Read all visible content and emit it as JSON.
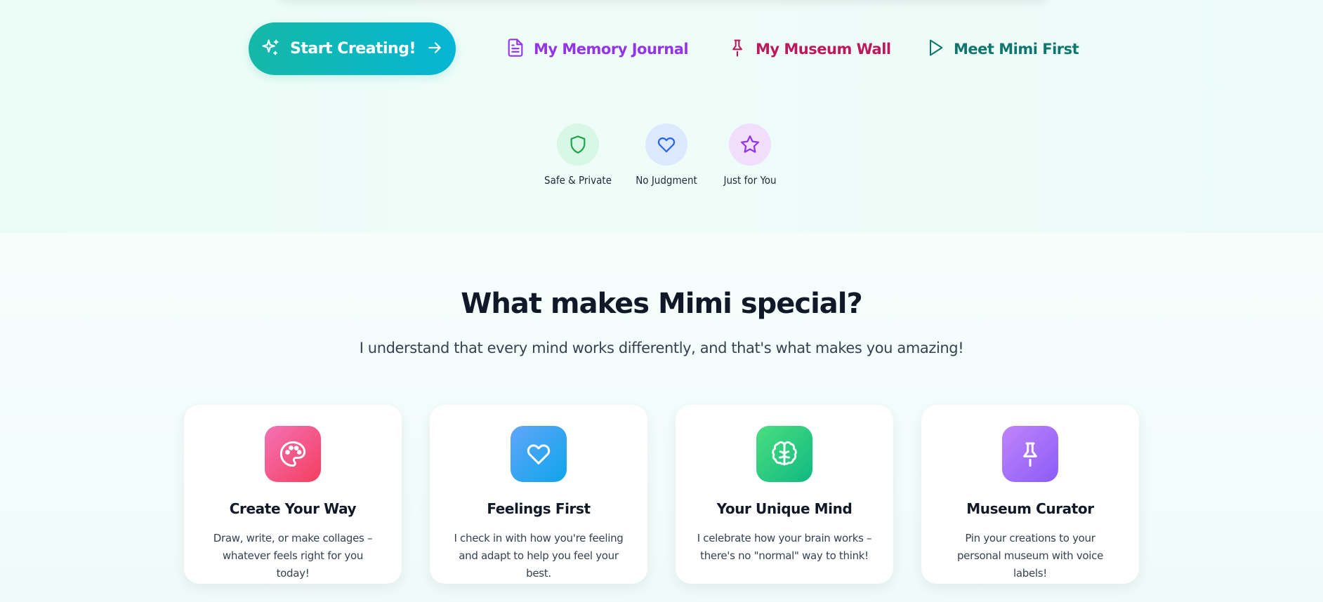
{
  "hero": {
    "cta": {
      "label": "Start Creating!",
      "icon": "sparkles-icon",
      "arrow_icon": "arrow-right-icon"
    },
    "nav_links": [
      {
        "label": "My Memory Journal",
        "icon": "document-icon",
        "color": "#9333ea"
      },
      {
        "label": "My Museum Wall",
        "icon": "pin-icon",
        "color": "#be185d"
      },
      {
        "label": "Meet Mimi First",
        "icon": "play-icon",
        "color": "#0f766e"
      }
    ],
    "trust_badges": [
      {
        "label": "Safe & Private",
        "icon": "shield-icon",
        "color": "#16a34a"
      },
      {
        "label": "No Judgment",
        "icon": "heart-icon",
        "color": "#2563eb"
      },
      {
        "label": "Just for You",
        "icon": "star-icon",
        "color": "#9333ea"
      }
    ]
  },
  "features": {
    "title": "What makes Mimi special?",
    "subtitle": "I understand that every mind works differently, and that's what makes you amazing!",
    "cards": [
      {
        "title": "Create Your Way",
        "description": "Draw, write, or make collages – whatever feels right for you today!",
        "icon": "palette-icon"
      },
      {
        "title": "Feelings First",
        "description": "I check in with how you're feeling and adapt to help you feel your best.",
        "icon": "heart-icon"
      },
      {
        "title": "Your Unique Mind",
        "description": "I celebrate how your brain works – there's no \"normal\" way to think!",
        "icon": "brain-icon"
      },
      {
        "title": "Museum Curator",
        "description": "Pin your creations to your personal museum with voice labels!",
        "icon": "pin-icon"
      }
    ]
  }
}
